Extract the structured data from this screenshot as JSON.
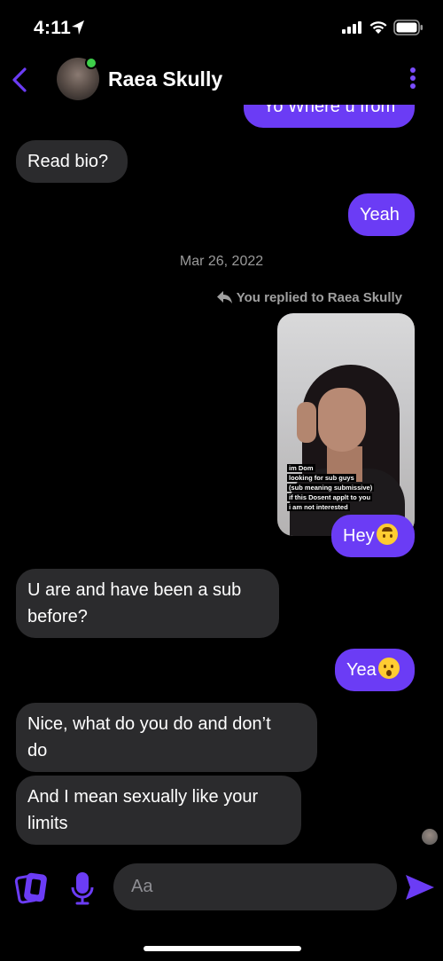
{
  "status_bar": {
    "time": "4:11"
  },
  "header": {
    "contact_name": "Raea Skully"
  },
  "messages": {
    "m0": "Yo Where u from",
    "m1": "Read bio?",
    "m2": "Yeah",
    "date": "Mar 26, 2022",
    "reply_note": "You replied to Raea Skully",
    "story_lines": [
      "im Dom",
      "looking for sub guys",
      "(sub meaning submissive)",
      "if this Dosent applt to you",
      "i am not interested"
    ],
    "m3": "Hey",
    "m4_line1": "U are and have been a sub",
    "m4_line2": "before?",
    "m5": "Yea",
    "m6_line1": "Nice, what do you do and don’t",
    "m6_line2": "do",
    "m7_line1": "And I mean sexually like your",
    "m7_line2": "limits"
  },
  "composer": {
    "placeholder": "Aa"
  },
  "colors": {
    "accent": "#6b3cf5",
    "incoming": "#2b2b2d",
    "background": "#000000",
    "online": "#3ecf4a"
  },
  "icons": [
    "back-chevron-icon",
    "more-options-icon",
    "reply-arrow-icon",
    "cards-icon",
    "microphone-icon",
    "send-icon",
    "location-arrow-icon",
    "signal-icon",
    "wifi-icon",
    "battery-icon"
  ]
}
